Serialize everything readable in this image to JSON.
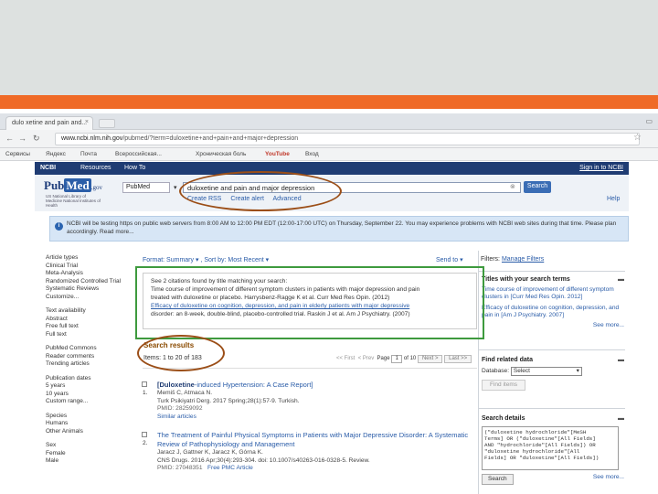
{
  "browser": {
    "tab_title": "dulo xetine and pain and...",
    "tab_close": "×",
    "url_host": "www.ncbi.nlm.nih.gov",
    "url_path": "/pubmed/?term=duloxetine+and+pain+and+major+depression",
    "bookmarks": [
      {
        "label": "Сервисы"
      },
      {
        "label": "Яндекс"
      },
      {
        "label": "Почта"
      },
      {
        "label": "Всероссийская..."
      },
      {
        "label": "Хроническая боль"
      },
      {
        "label": "YouTube"
      },
      {
        "label": "Вход"
      }
    ]
  },
  "ncbi_bar": {
    "brand": "NCBI",
    "resources": "Resources",
    "howto": "How To",
    "sign_in": "Sign in to NCBI"
  },
  "pubmed": {
    "logo_pub": "Pub",
    "logo_med": "Med",
    "logo_gov": ".gov",
    "logo_sub": "US National Library of Medicine National Institutes of Health",
    "db_select": "PubMed",
    "search_value": "duloxetine and pain and major depression",
    "search_button": "Search",
    "create_rss": "Create RSS",
    "create_alert": "Create alert",
    "advanced": "Advanced",
    "help": "Help"
  },
  "notice": {
    "text": "NCBI will be testing https on public web servers from 8:00 AM to 12:00 PM EDT (12:00-17:00 UTC) on Thursday, September 22. You may experience problems with NCBI web sites during that time. Please plan accordingly. Read more..."
  },
  "sidebar": {
    "groups": [
      [
        "Article types",
        "Clinical Trial",
        "Meta-Analysis",
        "Randomized Controlled Trial",
        "Systematic Reviews",
        "Customize..."
      ],
      [
        "Text availability",
        "Abstract",
        "Free full text",
        "Full text"
      ],
      [
        "PubMed Commons",
        "Reader comments",
        "Trending articles"
      ],
      [
        "Publication dates",
        "5 years",
        "10 years",
        "Custom range..."
      ],
      [
        "Species",
        "Humans",
        "Other Animals"
      ],
      [
        "Sex",
        "Female",
        "Male"
      ]
    ]
  },
  "results": {
    "format": "Format: Summary",
    "sort": "Sort by: Most Recent",
    "send_to": "Send to",
    "box_lines": [
      "See 2 citations found by title matching your search:",
      "Time course of improvement of different symptom clusters in patients with major depression and pain",
      "treated with duloxetine or placebo. Harrysbenz-Ragge K et al. Curr Med Res Opin. (2012)",
      "Efficacy of duloxetine on cognition, depression, and pain in elderly patients with major depressive",
      "disorder: an 8-week, double-blind, placebo-controlled trial. Raskin J et al. Am J Psychiatry. (2007)"
    ],
    "heading": "Search results",
    "items": "Items: 1 to 20 of 183",
    "pager_first": "<< First",
    "pager_prev": "< Prev",
    "page_label": "Page",
    "page_value": "1",
    "page_of": "of 10",
    "next": "Next >",
    "last": "Last >>",
    "citations": [
      {
        "num": "1.",
        "title_bold": "[Duloxetine",
        "title_rest": "-induced Hypertension: A Case Report]",
        "authors": "Memiš C, Atmaca N.",
        "journal": "Turk Psikiyatri Derg. 2017 Spring;28(1):57-9. Turkish.",
        "pmid": "PMID: 28259092",
        "extra": "Similar articles"
      },
      {
        "num": "2.",
        "title_bold": "",
        "title_rest": "The Treatment of Painful Physical Symptoms in Patients with Major Depressive Disorder: A Systematic",
        "title_line2": "Review of Pathophysiology and Management",
        "authors": "Jaracz J, Gattner K, Jaracz K, Górna K.",
        "journal": "CNS Drugs. 2016 Apr;30(4):293-304. doi: 10.1007/s40263-016-0328-5. Review.",
        "pmid": "PMID: 27048351",
        "extra": "Free PMC Article"
      }
    ]
  },
  "right": {
    "filters_label": "Filters:",
    "manage_filters": "Manage Filters",
    "titles_heading": "Titles with your search terms",
    "title1": "Time course of improvement of different symptom clusters in [Curr Med Res Opin. 2012]",
    "title2": "Efficacy of duloxetine on cognition, depression, and pain in [Am J Psychiatry. 2007]",
    "see_more": "See more...",
    "related_heading": "Find related data",
    "database_label": "Database:",
    "database_value": "Select",
    "find_items": "Find items",
    "details_heading": "Search details",
    "details_text": "(\"duloxetine hydrochloride\"[MeSH\nTerms] OR (\"duloxetine\"[All Fields]\nAND \"hydrochloride\"[All Fields]) OR\n\"duloxetine hydrochloride\"[All\nFields] OR \"duloxetine\"[All Fields])",
    "search_btn": "Search",
    "see_more2": "See more..."
  }
}
